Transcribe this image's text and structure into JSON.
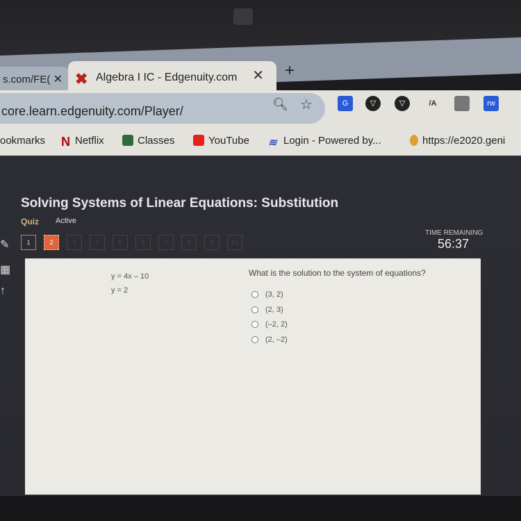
{
  "browser": {
    "inactive_tab": {
      "title": "s.com/FE(",
      "close": "✕"
    },
    "active_tab": {
      "title": "Algebra I IC - Edgenuity.com",
      "close": "✕",
      "favicon": "edgenuity-x-icon"
    },
    "new_tab": "+",
    "url": "core.learn.edgenuity.com/Player/",
    "omnibox_icons": [
      "zoom-icon",
      "star-icon"
    ],
    "extensions": [
      {
        "name": "google-translate-extension",
        "label": "G",
        "color": "#2a5bd7"
      },
      {
        "name": "extension-2",
        "label": "",
        "color": "#222222"
      },
      {
        "name": "extension-3",
        "label": "",
        "color": "#222222"
      },
      {
        "name": "extension-4",
        "label": "/A",
        "color": "#555555"
      },
      {
        "name": "extension-5",
        "label": "",
        "color": "#666666"
      },
      {
        "name": "rw-extension",
        "label": "rw",
        "color": "#2a5bd7"
      }
    ],
    "bookmarks": [
      {
        "label": "ookmarks",
        "icon": ""
      },
      {
        "label": "Netflix",
        "icon": "netflix-icon",
        "color": "#b1060f"
      },
      {
        "label": "Classes",
        "icon": "classroom-icon",
        "color": "#2e6b3a"
      },
      {
        "label": "YouTube",
        "icon": "youtube-icon",
        "color": "#e62117"
      },
      {
        "label": "Login - Powered by...",
        "icon": "login-icon",
        "color": "#3a5bbf"
      },
      {
        "label": "https://e2020.geni",
        "icon": "lightbulb-icon",
        "color": "#e0a030"
      }
    ]
  },
  "lesson": {
    "title": "Solving Systems of Linear Equations: Substitution",
    "type": "Quiz",
    "status": "Active",
    "questions": [
      "1",
      "2",
      "3",
      "4",
      "5",
      "6",
      "7",
      "8",
      "9",
      "10"
    ],
    "current_question": 2,
    "time_label": "TIME REMAINING",
    "time_remaining": "56:37"
  },
  "question": {
    "equations": [
      "y = 4x – 10",
      "y = 2"
    ],
    "prompt": "What is the solution to the system of equations?",
    "options": [
      "(3, 2)",
      "(2, 3)",
      "(–2, 2)",
      "(2, –2)"
    ]
  }
}
